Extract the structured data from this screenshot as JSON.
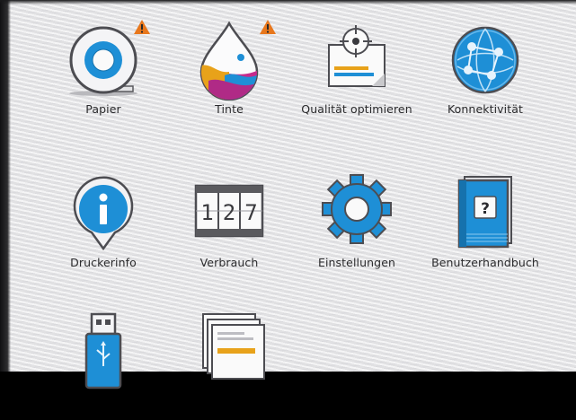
{
  "tiles": [
    {
      "label": "Papier",
      "icon": "paper-roll-icon",
      "warning": true
    },
    {
      "label": "Tinte",
      "icon": "ink-drop-icon",
      "warning": true
    },
    {
      "label": "Qualität optimieren",
      "icon": "print-quality-icon",
      "warning": false
    },
    {
      "label": "Konnektivität",
      "icon": "globe-network-icon",
      "warning": false
    },
    {
      "label": "Druckerinfo",
      "icon": "info-pin-icon",
      "warning": false
    },
    {
      "label": "Verbrauch",
      "icon": "usage-counter-icon",
      "warning": false
    },
    {
      "label": "Einstellungen",
      "icon": "gear-icon",
      "warning": false
    },
    {
      "label": "Benutzerhandbuch",
      "icon": "help-book-icon",
      "warning": false
    },
    {
      "label": "",
      "icon": "usb-drive-icon",
      "warning": false
    },
    {
      "label": "",
      "icon": "print-jobs-icon",
      "warning": false
    }
  ],
  "counter": {
    "digit1": "1",
    "digit2": "2",
    "digit3": "7"
  },
  "help_glyph": "?",
  "colors": {
    "accent_blue": "#1e8fd6",
    "warning_orange": "#e8771c",
    "label_text": "#2b2b2d",
    "background": "#e9e9ea"
  }
}
